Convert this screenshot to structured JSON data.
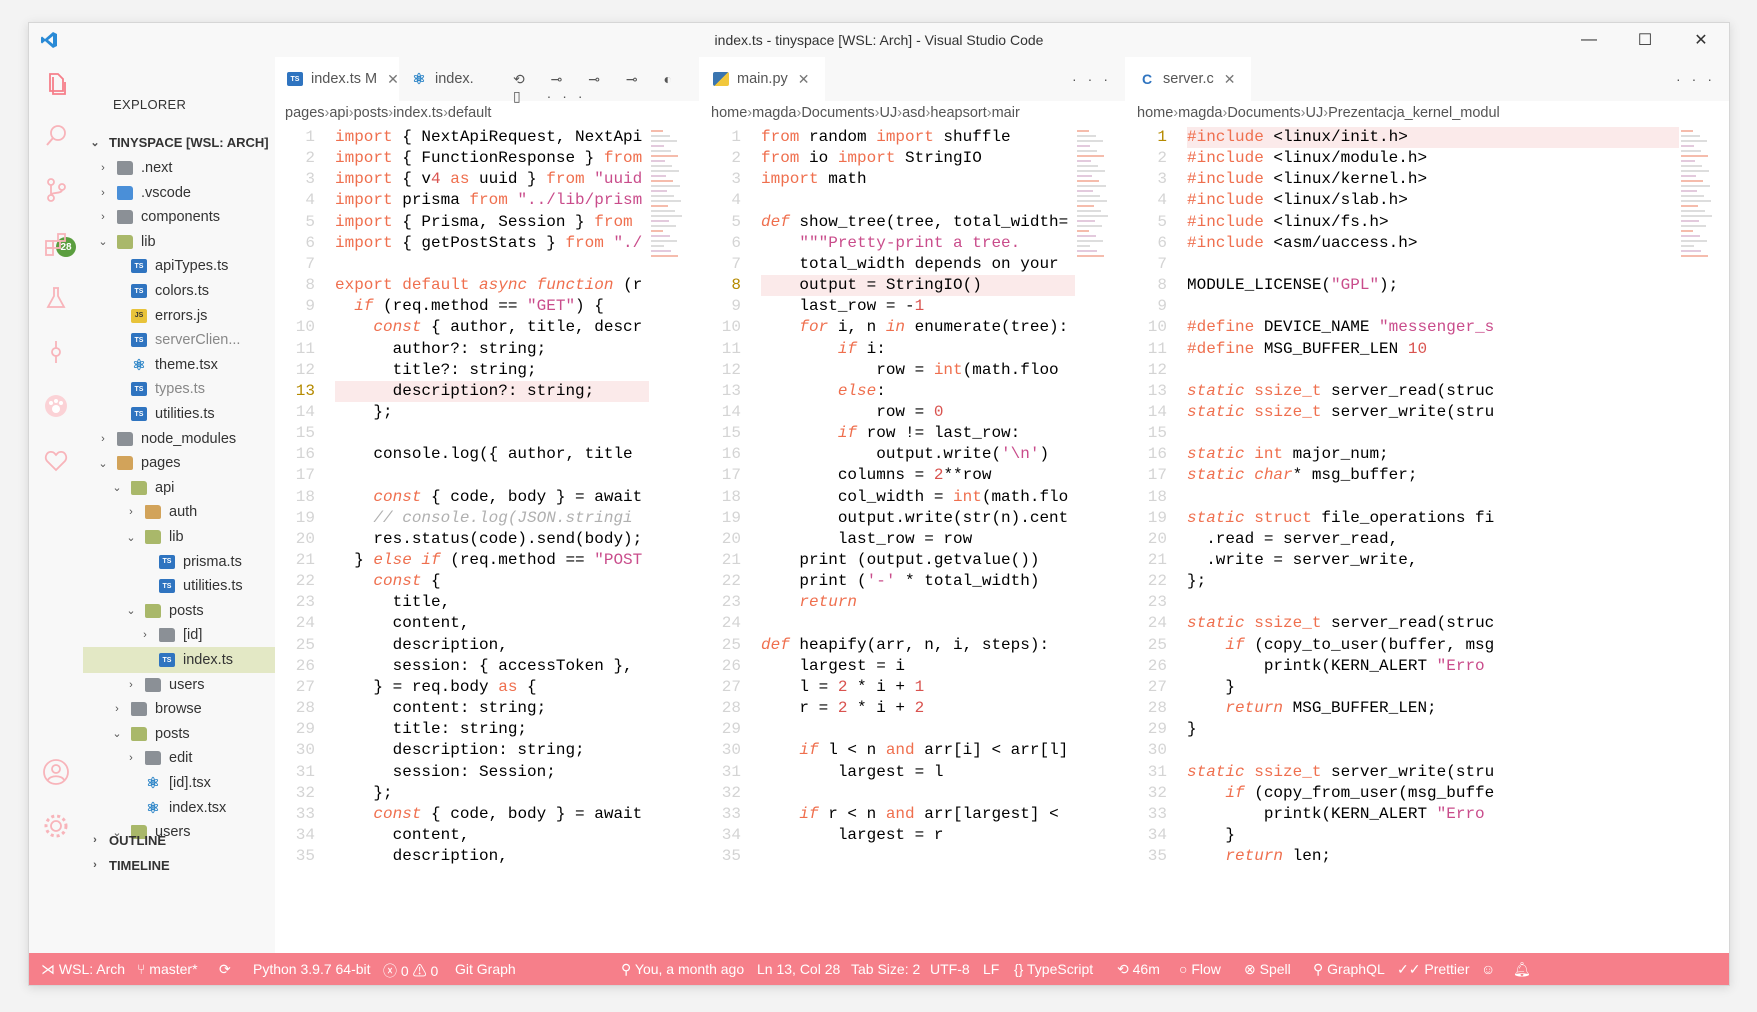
{
  "window": {
    "title": "index.ts - tinyspace [WSL: Arch] - Visual Studio Code"
  },
  "sidebar": {
    "header": "EXPLORER",
    "root": "TINYSPACE [WSL: ARCH]",
    "tree": [
      {
        "name": ".next",
        "kind": "folder",
        "depth": 1,
        "open": false,
        "status": ""
      },
      {
        "name": ".vscode",
        "kind": "folder-vscode",
        "depth": 1,
        "open": false,
        "status": ""
      },
      {
        "name": "components",
        "kind": "folder",
        "depth": 1,
        "open": false,
        "status": "dot"
      },
      {
        "name": "lib",
        "kind": "folder",
        "depth": 1,
        "open": true,
        "status": "dot"
      },
      {
        "name": "apiTypes.ts",
        "kind": "ts",
        "depth": 2,
        "status": "M"
      },
      {
        "name": "colors.ts",
        "kind": "ts",
        "depth": 2,
        "status": ""
      },
      {
        "name": "errors.js",
        "kind": "js",
        "depth": 2,
        "status": ""
      },
      {
        "name": "serverClien...",
        "kind": "ts",
        "depth": 2,
        "status": "U"
      },
      {
        "name": "theme.tsx",
        "kind": "react",
        "depth": 2,
        "status": ""
      },
      {
        "name": "types.ts",
        "kind": "ts",
        "depth": 2,
        "status": "U"
      },
      {
        "name": "utilities.ts",
        "kind": "ts",
        "depth": 2,
        "status": ""
      },
      {
        "name": "node_modules",
        "kind": "folder",
        "depth": 1,
        "open": false,
        "status": ""
      },
      {
        "name": "pages",
        "kind": "folder-open",
        "depth": 1,
        "open": true,
        "status": "dot"
      },
      {
        "name": "api",
        "kind": "folder",
        "depth": 2,
        "open": true,
        "status": "dot"
      },
      {
        "name": "auth",
        "kind": "folder-open",
        "depth": 3,
        "open": false,
        "status": ""
      },
      {
        "name": "lib",
        "kind": "folder",
        "depth": 3,
        "open": true,
        "status": ""
      },
      {
        "name": "prisma.ts",
        "kind": "ts",
        "depth": 4,
        "status": ""
      },
      {
        "name": "utilities.ts",
        "kind": "ts",
        "depth": 4,
        "status": ""
      },
      {
        "name": "posts",
        "kind": "folder",
        "depth": 3,
        "open": true,
        "status": "dot"
      },
      {
        "name": "[id]",
        "kind": "folder",
        "depth": 4,
        "open": false,
        "status": "dot"
      },
      {
        "name": "index.ts",
        "kind": "ts",
        "depth": 4,
        "status": "M",
        "selected": true
      },
      {
        "name": "users",
        "kind": "folder",
        "depth": 3,
        "open": false,
        "status": ""
      },
      {
        "name": "browse",
        "kind": "folder",
        "depth": 2,
        "open": false,
        "status": ""
      },
      {
        "name": "posts",
        "kind": "folder",
        "depth": 2,
        "open": true,
        "status": "dot"
      },
      {
        "name": "edit",
        "kind": "folder",
        "depth": 3,
        "open": false,
        "status": ""
      },
      {
        "name": "[id].tsx",
        "kind": "react",
        "depth": 3,
        "status": ""
      },
      {
        "name": "index.tsx",
        "kind": "react",
        "depth": 3,
        "status": "M"
      },
      {
        "name": "users",
        "kind": "folder",
        "depth": 2,
        "open": true,
        "status": "dot"
      }
    ],
    "outline": "OUTLINE",
    "timeline": "TIMELINE",
    "scm_badge": "28"
  },
  "editors": [
    {
      "tabs": [
        {
          "label": "index.ts",
          "icon": "TS",
          "suffix": "M",
          "active": true,
          "close": "✕"
        },
        {
          "label": "index.",
          "icon": "react",
          "suffix": "",
          "active": false,
          "close": ""
        }
      ],
      "breadcrumb": [
        "pages",
        "api",
        "posts",
        "index.ts",
        "default"
      ],
      "start_line": 1,
      "current_line": 13,
      "lines": [
        "import { NextApiRequest, NextApi",
        "import { FunctionResponse } from",
        "import { v4 as uuid } from \"uuid",
        "import prisma from \"../lib/prism",
        "import { Prisma, Session } from",
        "import { getPostStats } from \"./",
        "",
        "export default async function (r",
        "  if (req.method == \"GET\") {",
        "    const { author, title, descr",
        "      author?: string;",
        "      title?: string;",
        "      description?: string;",
        "    };",
        "",
        "    console.log({ author, title",
        "",
        "    const { code, body } = await",
        "    // console.log(JSON.stringi",
        "    res.status(code).send(body);",
        "  } else if (req.method == \"POST",
        "    const {",
        "      title,",
        "      content,",
        "      description,",
        "      session: { accessToken },",
        "    } = req.body as {",
        "      content: string;",
        "      title: string;",
        "      description: string;",
        "      session: Session;",
        "    };",
        "    const { code, body } = await",
        "      content,",
        "      description,"
      ]
    },
    {
      "tabs": [
        {
          "label": "main.py",
          "icon": "py",
          "suffix": "",
          "active": true,
          "close": "✕"
        }
      ],
      "breadcrumb": [
        "home",
        "magda",
        "Documents",
        "UJ",
        "asd",
        "heapsort",
        "mair"
      ],
      "start_line": 1,
      "current_line": 8,
      "lines": [
        "from random import shuffle",
        "from io import StringIO",
        "import math",
        "",
        "def show_tree(tree, total_width=",
        "    \"\"\"Pretty-print a tree.",
        "    total_width depends on your",
        "    output = StringIO()",
        "    last_row = -1",
        "    for i, n in enumerate(tree):",
        "        if i:",
        "            row = int(math.floo",
        "        else:",
        "            row = 0",
        "        if row != last_row:",
        "            output.write('\\n')",
        "        columns = 2**row",
        "        col_width = int(math.flo",
        "        output.write(str(n).cent",
        "        last_row = row",
        "    print (output.getvalue())",
        "    print ('-' * total_width)",
        "    return",
        "",
        "def heapify(arr, n, i, steps):",
        "    largest = i",
        "    l = 2 * i + 1",
        "    r = 2 * i + 2",
        "",
        "    if l < n and arr[i] < arr[l]",
        "        largest = l",
        "",
        "    if r < n and arr[largest] <",
        "        largest = r",
        ""
      ]
    },
    {
      "tabs": [
        {
          "label": "server.c",
          "icon": "C",
          "suffix": "",
          "active": true,
          "close": "✕"
        }
      ],
      "breadcrumb": [
        "home",
        "magda",
        "Documents",
        "UJ",
        "Prezentacja_kernel_modul"
      ],
      "start_line": 1,
      "current_line": 1,
      "lines": [
        "#include <linux/init.h>",
        "#include <linux/module.h>",
        "#include <linux/kernel.h>",
        "#include <linux/slab.h>",
        "#include <linux/fs.h>",
        "#include <asm/uaccess.h>",
        "",
        "MODULE_LICENSE(\"GPL\");",
        "",
        "#define DEVICE_NAME \"messenger_s",
        "#define MSG_BUFFER_LEN 10",
        "",
        "static ssize_t server_read(struc",
        "static ssize_t server_write(stru",
        "",
        "static int major_num;",
        "static char* msg_buffer;",
        "",
        "static struct file_operations fi",
        "  .read = server_read,",
        "  .write = server_write,",
        "};",
        "",
        "static ssize_t server_read(struc",
        "    if (copy_to_user(buffer, msg",
        "        printk(KERN_ALERT \"Erro",
        "    }",
        "    return MSG_BUFFER_LEN;",
        "}",
        "",
        "static ssize_t server_write(stru",
        "    if (copy_from_user(msg_buffe",
        "        printk(KERN_ALERT \"Erro",
        "    }",
        "    return len;"
      ]
    }
  ],
  "statusbar": {
    "remote": "WSL: Arch",
    "branch": "master*",
    "python": "Python 3.9.7 64-bit",
    "problems": "0",
    "warnings": "0",
    "git_graph": "Git Graph",
    "blame": "You, a month ago",
    "position": "Ln 13, Col 28",
    "tab_size": "Tab Size: 2",
    "encoding": "UTF-8",
    "eol": "LF",
    "language": "TypeScript",
    "time": "46m",
    "flow": "Flow",
    "spell": "Spell",
    "graphql": "GraphQL",
    "prettier": "Prettier"
  },
  "colors": {
    "accent": "#f67f8a",
    "keyword": "#ef6f4e",
    "text": "#333333",
    "string": "#c94c8b",
    "comment": "#b0b0b0"
  }
}
